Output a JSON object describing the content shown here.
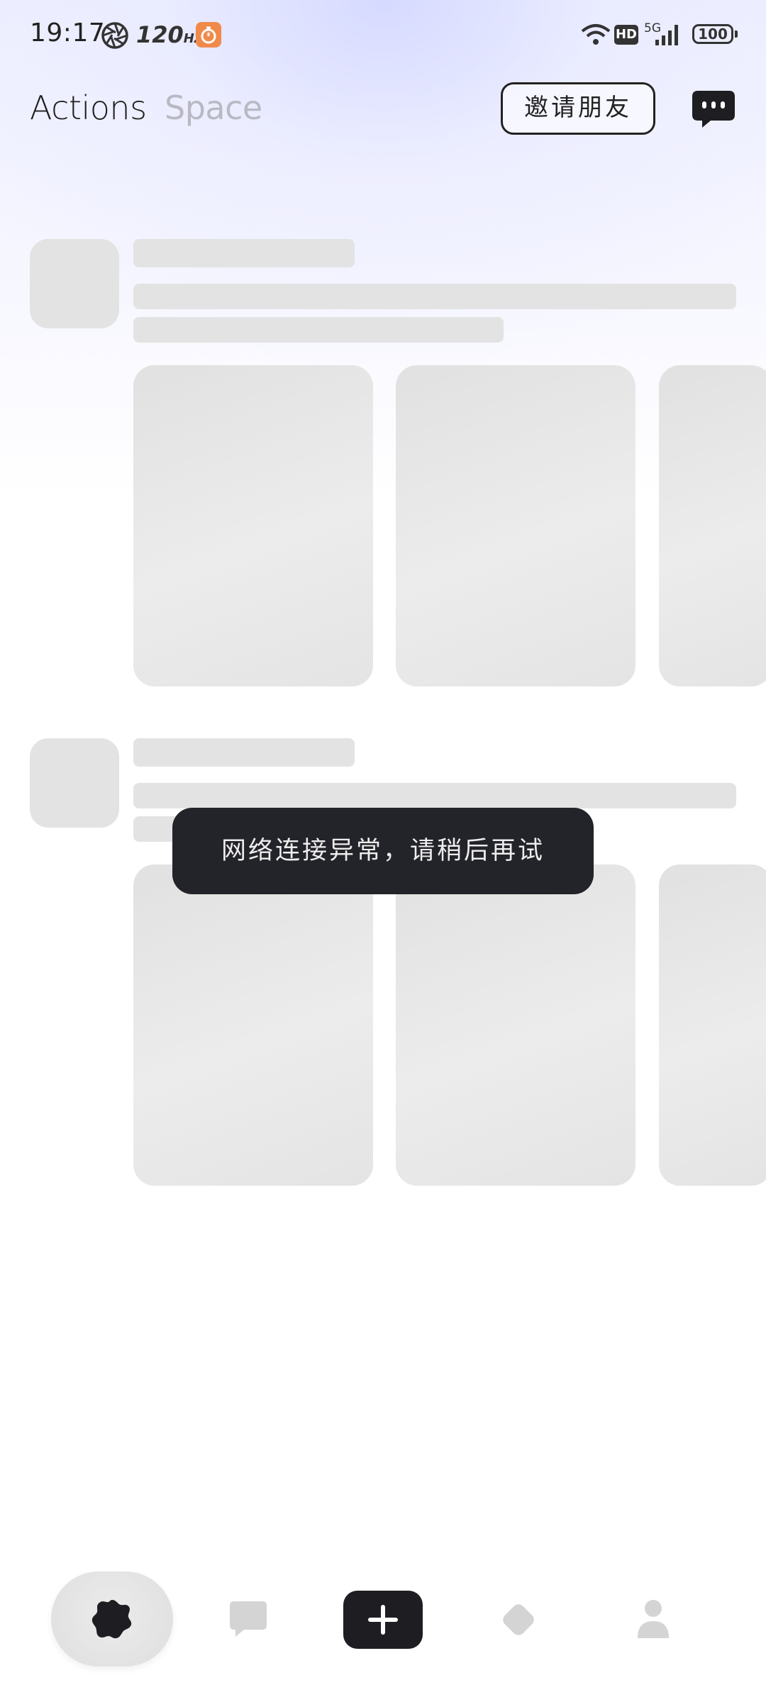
{
  "status_bar": {
    "time": "19:17",
    "refresh_rate": "120",
    "refresh_unit": "HZ",
    "hd_label": "HD",
    "network": "5G",
    "battery": "100"
  },
  "header": {
    "tabs": [
      {
        "label": "Actions",
        "active": true
      },
      {
        "label": "Space",
        "active": false
      }
    ],
    "invite_button": "邀请朋友",
    "message_icon": "chat-bubble-dots-icon"
  },
  "toast": {
    "message": "网络连接异常，请稍后再试"
  },
  "bottom_nav": {
    "items": [
      {
        "icon": "flower-home-icon",
        "selected": true
      },
      {
        "icon": "chat-icon",
        "selected": false
      },
      {
        "icon": "plus-icon",
        "selected": false
      },
      {
        "icon": "diamond-explore-icon",
        "selected": false
      },
      {
        "icon": "person-icon",
        "selected": false
      }
    ]
  },
  "colors": {
    "accent_dark": "#1d1d22",
    "skeleton": "#e3e3e3",
    "inactive_tab": "#b9b9c4",
    "timer_orange": "#f08a4b"
  }
}
